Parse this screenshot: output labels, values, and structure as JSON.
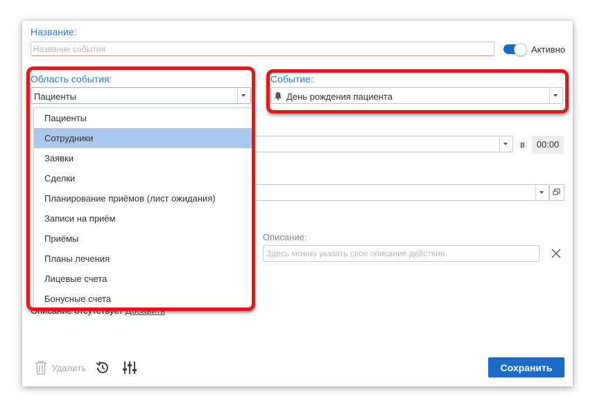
{
  "name_field": {
    "label": "Название:",
    "placeholder": "Название события",
    "value": ""
  },
  "active_toggle": {
    "label": "Активно",
    "on": true
  },
  "area": {
    "label": "Область события:",
    "selected": "Пациенты",
    "options": [
      "Пациенты",
      "Сотрудники",
      "Заявки",
      "Сделки",
      "Планирование приёмов (лист ожидания)",
      "Записи на приём",
      "Приёмы",
      "Планы лечения",
      "Лицевые счета",
      "Бонусные счета"
    ],
    "highlighted_index": 1
  },
  "event": {
    "label": "Событие:",
    "selected": "День рождения пациента",
    "icon": "bell-icon"
  },
  "schedule": {
    "at_label": "в",
    "time": "00:00"
  },
  "description": {
    "label": "Описание:",
    "placeholder": "Здесь можно указать свое описание действия"
  },
  "description_note": {
    "text": "Описание отсутствует",
    "link": "Добавить"
  },
  "footer": {
    "delete_label": "Удалить",
    "save_label": "Сохранить"
  },
  "colors": {
    "accent": "#1b6cc9",
    "label_blue": "#2a7fd4",
    "highlight": "#a8c8ec",
    "annotation_red": "#ef1414"
  }
}
